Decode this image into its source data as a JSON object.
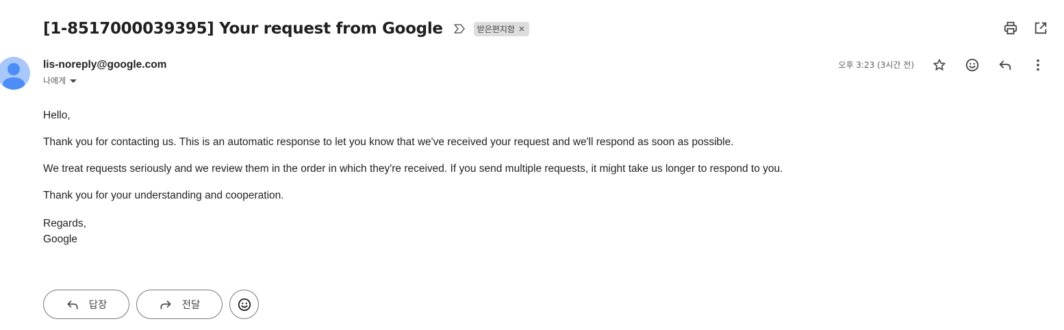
{
  "email": {
    "subject": "[1-8517000039395] Your request from Google",
    "label_chip": "받은편지함",
    "label_remove": "×",
    "sender_email": "lis-noreply@google.com",
    "recipient_text": "나에게",
    "timestamp": "오후 3:23 (3시간 전)",
    "body": {
      "greeting": "Hello,",
      "paragraph_1": "Thank you for contacting us. This is an automatic response to let you know that we've received your request and we'll respond as soon as possible.",
      "paragraph_2": "We treat requests seriously and we review them in the order in which they're received. If you send multiple requests, it might take us longer to respond to you.",
      "paragraph_3": "Thank you for your understanding and cooperation.",
      "closing": "Regards,",
      "signature": "Google"
    }
  },
  "actions": {
    "reply_label": "답장",
    "forward_label": "전달"
  },
  "icons": {
    "top": [
      "print-icon",
      "open-in-new-window-icon"
    ],
    "message": [
      "star-icon",
      "emoji-reaction-icon",
      "reply-icon",
      "more-vert-icon"
    ],
    "bottom": [
      "reply-icon",
      "forward-icon",
      "emoji-reaction-icon"
    ]
  },
  "colors": {
    "avatar_bg": "#a8c7fa",
    "avatar_fg": "#4c8df6",
    "label_chip_bg": "#dddddd",
    "icon": "#444746"
  }
}
